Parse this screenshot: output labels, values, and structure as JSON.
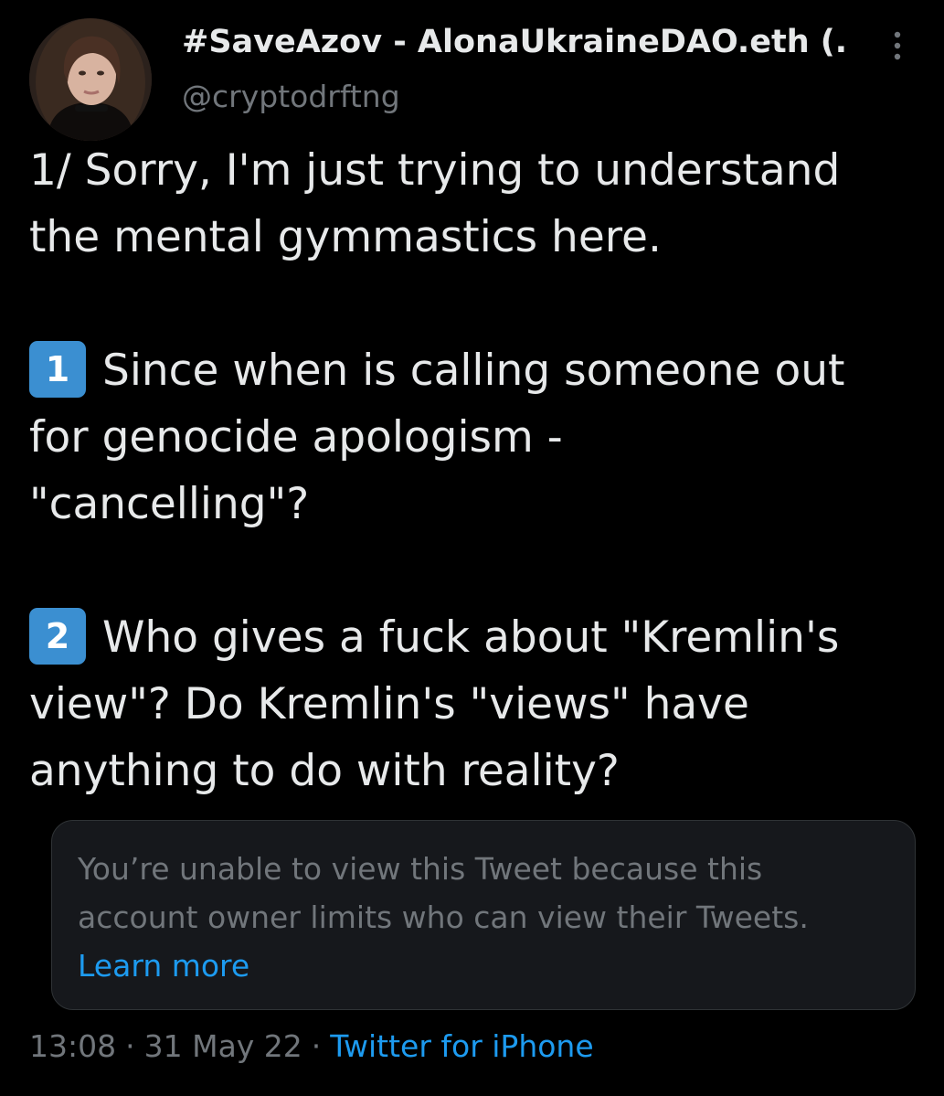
{
  "author": {
    "display_name": "#SaveAzov - AlonaUkraineDAO.eth (...",
    "handle": "@cryptodrftng",
    "avatar_icon": "profile-photo"
  },
  "more_icon": "vertical-ellipsis-icon",
  "tweet": {
    "lines": [
      "1/ Sorry, I'm just trying to understand",
      "the mental gymmastics here."
    ],
    "point1": {
      "badge": "1",
      "lines": [
        "Since when is calling someone out",
        "for genocide apologism -",
        "\"cancelling\"?"
      ]
    },
    "point2": {
      "badge": "2",
      "lines": [
        "Who gives a fuck about \"Kremlin's",
        "view\"? Do Kremlin's \"views\" have",
        "anything to do with reality?"
      ]
    }
  },
  "quoted_notice": {
    "line1": "You’re unable to view this Tweet because this",
    "line2": "account owner limits who can view their Tweets.",
    "link": "Learn more"
  },
  "meta": {
    "time": "13:08",
    "separator": "·",
    "date": "31 May 22",
    "source": "Twitter for iPhone"
  },
  "colors": {
    "background": "#000000",
    "text": "#e7e9ea",
    "muted": "#71767b",
    "link": "#1d9bf0",
    "keycap": "#3b8fd1",
    "card": "#16181c"
  }
}
